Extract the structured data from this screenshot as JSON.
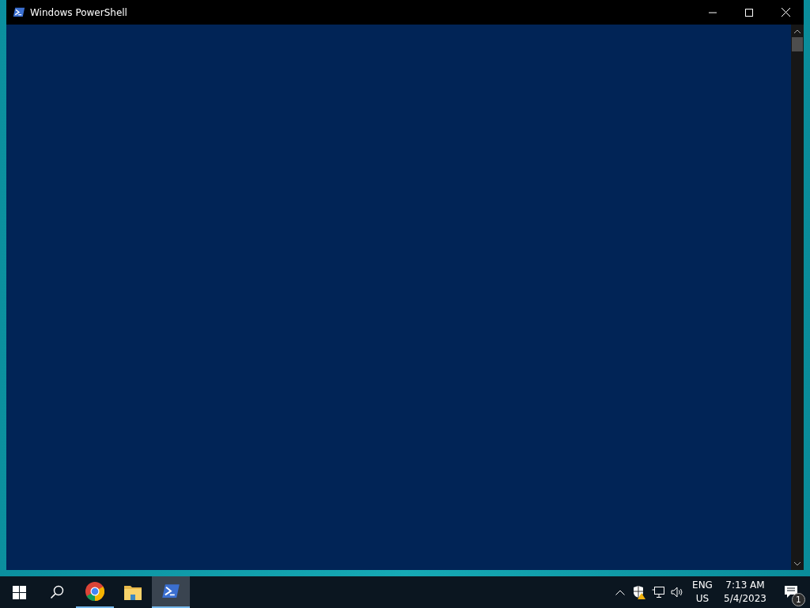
{
  "window": {
    "title": "Windows PowerShell"
  },
  "taskbar": {
    "apps": [
      {
        "kind": "start",
        "running": false,
        "selected": false
      },
      {
        "kind": "search",
        "running": false,
        "selected": false
      },
      {
        "kind": "chrome",
        "running": true,
        "selected": false
      },
      {
        "kind": "explorer",
        "running": false,
        "selected": false
      },
      {
        "kind": "powershell",
        "running": true,
        "selected": true
      }
    ],
    "tray": {
      "language": "ENG",
      "region": "US",
      "time": "7:13 AM",
      "date": "5/4/2023",
      "notification_count": "1"
    }
  }
}
